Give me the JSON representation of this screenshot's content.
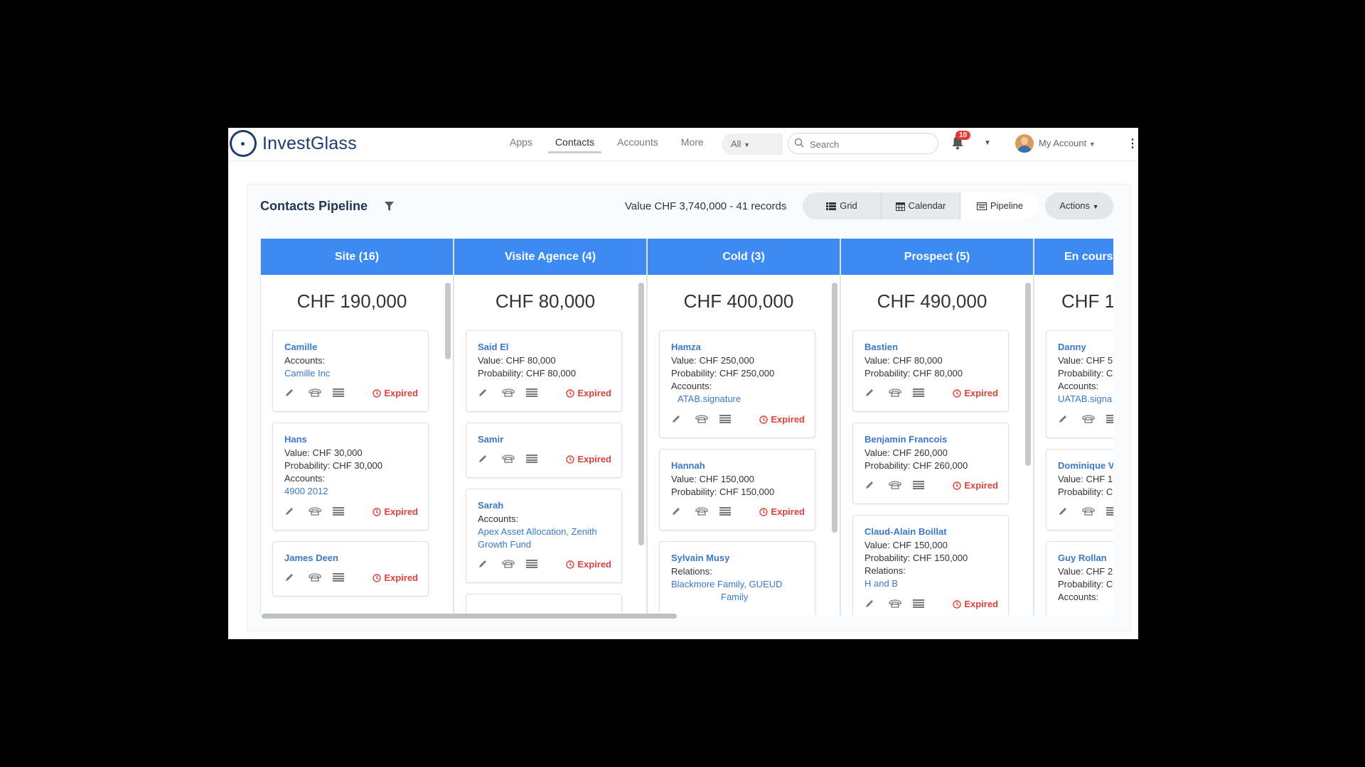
{
  "brand": {
    "name": "InvestGlass"
  },
  "nav": {
    "items": [
      "Apps",
      "Contacts",
      "Accounts",
      "More"
    ],
    "active": "Contacts"
  },
  "search": {
    "scope": "All",
    "placeholder": "Search"
  },
  "notifications": {
    "count": "10"
  },
  "account": {
    "label": "My Account"
  },
  "page": {
    "title": "Contacts Pipeline",
    "summary": "Value CHF 3,740,000 - 41 records",
    "views": [
      "Grid",
      "Calendar",
      "Pipeline"
    ],
    "active_view": "Pipeline",
    "actions_label": "Actions"
  },
  "expired_label": "Expired",
  "columns": [
    {
      "title": "Site (16)",
      "total": "CHF 190,000",
      "cards": [
        {
          "name": "Camille",
          "lines": [
            {
              "t": "Accounts:"
            }
          ],
          "links": [
            "Camille Inc"
          ]
        },
        {
          "name": "Hans",
          "lines": [
            {
              "t": "Value: CHF 30,000"
            },
            {
              "t": "Probability: CHF 30,000"
            },
            {
              "t": "Accounts:"
            }
          ],
          "links": [
            "4900 2012"
          ]
        },
        {
          "name": "James Deen",
          "lines": [],
          "links": []
        }
      ]
    },
    {
      "title": "Visite Agence (4)",
      "total": "CHF 80,000",
      "cards": [
        {
          "name": "Said El",
          "lines": [
            {
              "t": "Value: CHF 80,000"
            },
            {
              "t": "Probability: CHF 80,000"
            }
          ],
          "links": []
        },
        {
          "name": "Samir",
          "lines": [],
          "links": []
        },
        {
          "name": "Sarah",
          "lines": [
            {
              "t": "Accounts:"
            }
          ],
          "links": [
            "Apex Asset Allocation, Zenith",
            "Growth Fund"
          ]
        }
      ]
    },
    {
      "title": "Cold (3)",
      "total": "CHF 400,000",
      "cards": [
        {
          "name": "Hamza",
          "lines": [
            {
              "t": "Value: CHF 250,000"
            },
            {
              "t": "Probability: CHF 250,000"
            },
            {
              "t": "Accounts:"
            }
          ],
          "links": [
            "ATAB.signature"
          ]
        },
        {
          "name": "Hannah",
          "lines": [
            {
              "t": "Value: CHF 150,000"
            },
            {
              "t": "Probability: CHF 150,000"
            }
          ],
          "links": []
        },
        {
          "name": "Sylvain Musy",
          "lines": [
            {
              "t": "Relations:"
            }
          ],
          "links": [
            "Blackmore Family, GUEUD",
            "Family"
          ]
        }
      ]
    },
    {
      "title": "Prospect (5)",
      "total": "CHF 490,000",
      "cards": [
        {
          "name": "Bastien",
          "lines": [
            {
              "t": "Value: CHF 80,000"
            },
            {
              "t": "Probability: CHF 80,000"
            }
          ],
          "links": []
        },
        {
          "name": "Benjamin Francois",
          "lines": [
            {
              "t": "Value: CHF 260,000"
            },
            {
              "t": "Probability: CHF 260,000"
            }
          ],
          "links": []
        },
        {
          "name": "Claud-Alain Boillat",
          "lines": [
            {
              "t": "Value: CHF 150,000"
            },
            {
              "t": "Probability: CHF 150,000"
            },
            {
              "t": "Relations:"
            }
          ],
          "links": [
            "H and B"
          ]
        }
      ]
    },
    {
      "title": "En cours",
      "total": "CHF 1",
      "cards": [
        {
          "name": "Danny",
          "lines": [
            {
              "t": "Value: CHF 5"
            },
            {
              "t": "Probability: C"
            },
            {
              "t": "Accounts:"
            }
          ],
          "links": [
            "UATAB.signa"
          ]
        },
        {
          "name": "Dominique V",
          "lines": [
            {
              "t": "Value: CHF 1"
            },
            {
              "t": "Probability: C"
            }
          ],
          "links": []
        },
        {
          "name": "Guy Rollan",
          "lines": [
            {
              "t": "Value: CHF 2"
            },
            {
              "t": "Probability: C"
            },
            {
              "t": "Accounts:"
            }
          ],
          "links": []
        }
      ]
    }
  ],
  "colors": {
    "column_header": "#3d8bf2",
    "link": "#3a78c9",
    "expired": "#e0413d",
    "title": "#1e3557"
  },
  "icons": [
    "edit-icon",
    "phone-icon",
    "details-icon",
    "clock-icon",
    "filter-icon",
    "bell-icon",
    "grid-icon",
    "calendar-icon",
    "pipeline-icon",
    "search-icon"
  ]
}
